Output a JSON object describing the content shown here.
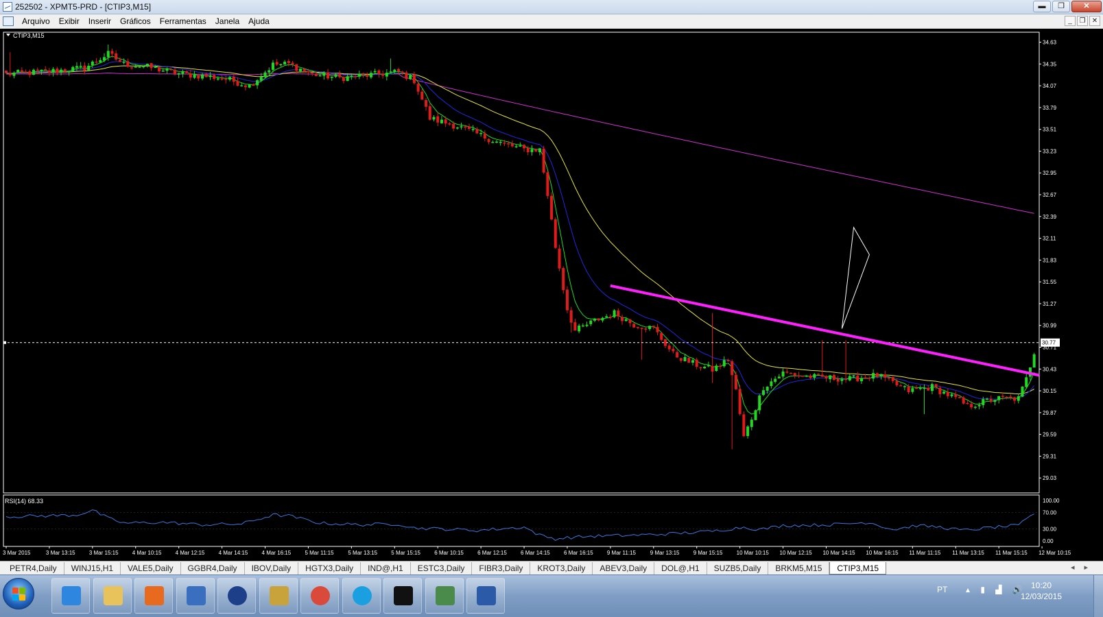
{
  "window": {
    "title": "252502 - XPMT5-PRD - [CTIP3,M15]",
    "buttons": {
      "minimize": "▬",
      "maximize": "❐",
      "close": "✕"
    }
  },
  "menu": {
    "items": [
      "Arquivo",
      "Exibir",
      "Inserir",
      "Gráficos",
      "Ferramentas",
      "Janela",
      "Ajuda"
    ],
    "mdi_buttons": {
      "minimize": "_",
      "restore": "❐",
      "close": "✕"
    }
  },
  "colors": {
    "background": "#000000",
    "bull": "#22d822",
    "bear": "#e11a1a",
    "ma_fast": "#19e019",
    "ma_mid": "#2424e8",
    "ma_slow": "#e8e630",
    "ma_long": "#d030d0",
    "trendline": "#ff20ff",
    "rsi": "#3a78e0",
    "axis": "#ffffff",
    "grid": "#808080"
  },
  "chart_data": {
    "type": "candlestick",
    "symbol_label": "CTIP3,M15",
    "price_axis": [
      "34.63",
      "34.35",
      "34.07",
      "33.79",
      "33.51",
      "33.23",
      "32.95",
      "32.67",
      "32.39",
      "32.11",
      "31.83",
      "31.55",
      "31.27",
      "30.99",
      "30.71",
      "30.43",
      "30.15",
      "29.87",
      "29.59",
      "29.31",
      "29.03"
    ],
    "ylim": [
      28.75,
      34.67
    ],
    "current_price": {
      "label": "30.77",
      "value": 30.77
    },
    "time_axis": [
      "3 Mar 2015",
      "3 Mar 13:15",
      "3 Mar 15:15",
      "4 Mar 10:15",
      "4 Mar 12:15",
      "4 Mar 14:15",
      "4 Mar 16:15",
      "5 Mar 11:15",
      "5 Mar 13:15",
      "5 Mar 15:15",
      "6 Mar 10:15",
      "6 Mar 12:15",
      "6 Mar 14:15",
      "6 Mar 16:15",
      "9 Mar 11:15",
      "9 Mar 13:15",
      "9 Mar 15:15",
      "10 Mar 10:15",
      "10 Mar 12:15",
      "10 Mar 14:15",
      "10 Mar 16:15",
      "11 Mar 11:15",
      "11 Mar 13:15",
      "11 Mar 15:15",
      "12 Mar 10:15"
    ],
    "close_anchors": [
      [
        0,
        34.22
      ],
      [
        10,
        34.25
      ],
      [
        20,
        34.3
      ],
      [
        26,
        34.48
      ],
      [
        30,
        34.35
      ],
      [
        35,
        34.32
      ],
      [
        45,
        34.22
      ],
      [
        55,
        34.17
      ],
      [
        62,
        34.07
      ],
      [
        68,
        34.34
      ],
      [
        72,
        34.35
      ],
      [
        78,
        34.22
      ],
      [
        85,
        34.17
      ],
      [
        95,
        34.22
      ],
      [
        100,
        34.25
      ],
      [
        104,
        34.14
      ],
      [
        108,
        33.65
      ],
      [
        115,
        33.55
      ],
      [
        125,
        33.35
      ],
      [
        132,
        33.25
      ],
      [
        136,
        33.25
      ],
      [
        138,
        32.67
      ],
      [
        140,
        32.0
      ],
      [
        143,
        31.2
      ],
      [
        145,
        30.92
      ],
      [
        150,
        31.05
      ],
      [
        155,
        31.15
      ],
      [
        160,
        31.0
      ],
      [
        165,
        30.95
      ],
      [
        170,
        30.62
      ],
      [
        175,
        30.5
      ],
      [
        180,
        30.42
      ],
      [
        184,
        30.55
      ],
      [
        186,
        30.15
      ],
      [
        188,
        29.55
      ],
      [
        190,
        29.8
      ],
      [
        193,
        30.2
      ],
      [
        198,
        30.38
      ],
      [
        205,
        30.33
      ],
      [
        215,
        30.3
      ],
      [
        222,
        30.35
      ],
      [
        226,
        30.25
      ],
      [
        230,
        30.15
      ],
      [
        236,
        30.2
      ],
      [
        242,
        30.05
      ],
      [
        245,
        29.95
      ],
      [
        252,
        30.05
      ],
      [
        258,
        30.05
      ],
      [
        260,
        30.3
      ],
      [
        262,
        30.65
      ]
    ],
    "volatility_spikes": [
      [
        1,
        34.5,
        null
      ],
      [
        26,
        34.6,
        null
      ],
      [
        98,
        34.42,
        null
      ],
      [
        144,
        null,
        30.9
      ],
      [
        162,
        null,
        30.55
      ],
      [
        180,
        31.15,
        30.25
      ],
      [
        185,
        null,
        29.4
      ],
      [
        208,
        30.8,
        null
      ],
      [
        214,
        30.8,
        null
      ],
      [
        234,
        null,
        29.85
      ]
    ],
    "moving_averages": [
      {
        "role": "fast",
        "period": 5
      },
      {
        "role": "mid",
        "period": 14
      },
      {
        "role": "slow",
        "period": 34
      },
      {
        "role": "long",
        "period": 200,
        "start": 34.22,
        "end": 32.45
      }
    ],
    "trendline": {
      "from": [
        "9 Mar 11:15",
        31.5
      ],
      "to": [
        "12 Mar 10:15",
        30.35
      ]
    },
    "drawing_triangle": [
      [
        213,
        30.95
      ],
      [
        216,
        32.25
      ],
      [
        220,
        31.9
      ]
    ],
    "rsi": {
      "label": "RSI(14) 68.33",
      "axis": [
        "100.00",
        "70.00",
        "30.00",
        "0.00"
      ],
      "ylim": [
        0,
        100
      ],
      "anchors": [
        [
          0,
          60
        ],
        [
          10,
          62
        ],
        [
          18,
          64
        ],
        [
          22,
          76
        ],
        [
          26,
          56
        ],
        [
          30,
          44
        ],
        [
          40,
          46
        ],
        [
          50,
          40
        ],
        [
          60,
          42
        ],
        [
          68,
          64
        ],
        [
          72,
          62
        ],
        [
          80,
          44
        ],
        [
          90,
          40
        ],
        [
          100,
          42
        ],
        [
          104,
          32
        ],
        [
          110,
          30
        ],
        [
          120,
          26
        ],
        [
          132,
          34
        ],
        [
          136,
          14
        ],
        [
          140,
          5
        ],
        [
          143,
          8
        ],
        [
          150,
          12
        ],
        [
          160,
          14
        ],
        [
          170,
          18
        ],
        [
          180,
          24
        ],
        [
          188,
          34
        ],
        [
          192,
          28
        ],
        [
          198,
          38
        ],
        [
          210,
          40
        ],
        [
          220,
          46
        ],
        [
          226,
          28
        ],
        [
          232,
          38
        ],
        [
          238,
          34
        ],
        [
          244,
          26
        ],
        [
          252,
          34
        ],
        [
          258,
          38
        ],
        [
          262,
          68
        ]
      ]
    }
  },
  "tabs": [
    "PETR4,Daily",
    "WINJ15,H1",
    "VALE5,Daily",
    "GGBR4,Daily",
    "IBOV,Daily",
    "HGTX3,Daily",
    "IND@,H1",
    "ESTC3,Daily",
    "FIBR3,Daily",
    "KROT3,Daily",
    "ABEV3,Daily",
    "DOL@,H1",
    "SUZB5,Daily",
    "BRKM5,M15",
    "CTIP3,M15"
  ],
  "active_tab": "CTIP3,M15",
  "tab_arrows": "◂▸",
  "taskbar": {
    "apps": [
      {
        "icon": "internet-explorer-icon",
        "color": "#2e86de"
      },
      {
        "icon": "file-explorer-icon",
        "color": "#e8c25a"
      },
      {
        "icon": "media-player-icon",
        "color": "#e86a1e"
      },
      {
        "icon": "pointer-app-icon",
        "color": "#3a6fc0"
      },
      {
        "icon": "hp-icon",
        "color": "#1d3f8a"
      },
      {
        "icon": "folder-sync-icon",
        "color": "#c8a23a"
      },
      {
        "icon": "chrome-icon",
        "color": "#d94a3a"
      },
      {
        "icon": "skype-icon",
        "color": "#1aa0e0"
      },
      {
        "icon": "xp-icon",
        "color": "#111111"
      },
      {
        "icon": "metatrader-icon",
        "color": "#4a8a4a"
      },
      {
        "icon": "word-icon",
        "color": "#2a5aa8"
      }
    ],
    "tray": {
      "language": "PT",
      "icons": "▴ ▮ ▟ 🔊",
      "time": "10:20",
      "date": "12/03/2015"
    }
  }
}
